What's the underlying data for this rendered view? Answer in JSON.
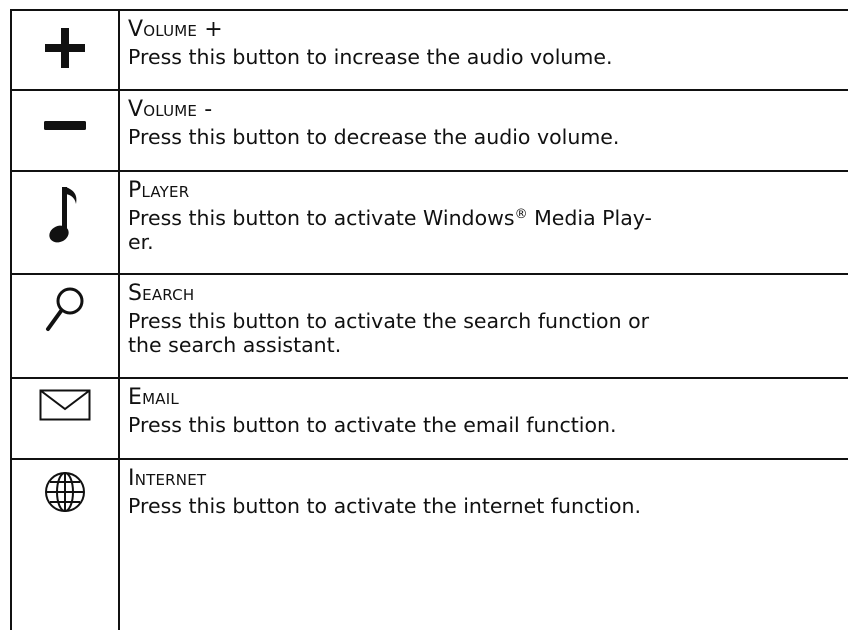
{
  "rows": [
    {
      "icon": "plus-icon",
      "title": "Volume +",
      "description": "Press this button to increase the audio volume."
    },
    {
      "icon": "minus-icon",
      "title": "Volume -",
      "description": "Press this button to decrease the audio volume."
    },
    {
      "icon": "music-note-icon",
      "title": "Player",
      "description_pre": "Press this button to activate Windows",
      "description_sup": "®",
      "description_post": " Media Play-",
      "description_line2": "er."
    },
    {
      "icon": "search-icon",
      "title": "Search",
      "description": "Press this button to activate the search function or",
      "description_line2": "the search assistant."
    },
    {
      "icon": "envelope-icon",
      "title": "Email",
      "description": "Press this button to activate the email function."
    },
    {
      "icon": "globe-icon",
      "title": "Internet",
      "description": "Press this button to activate the internet function."
    }
  ]
}
